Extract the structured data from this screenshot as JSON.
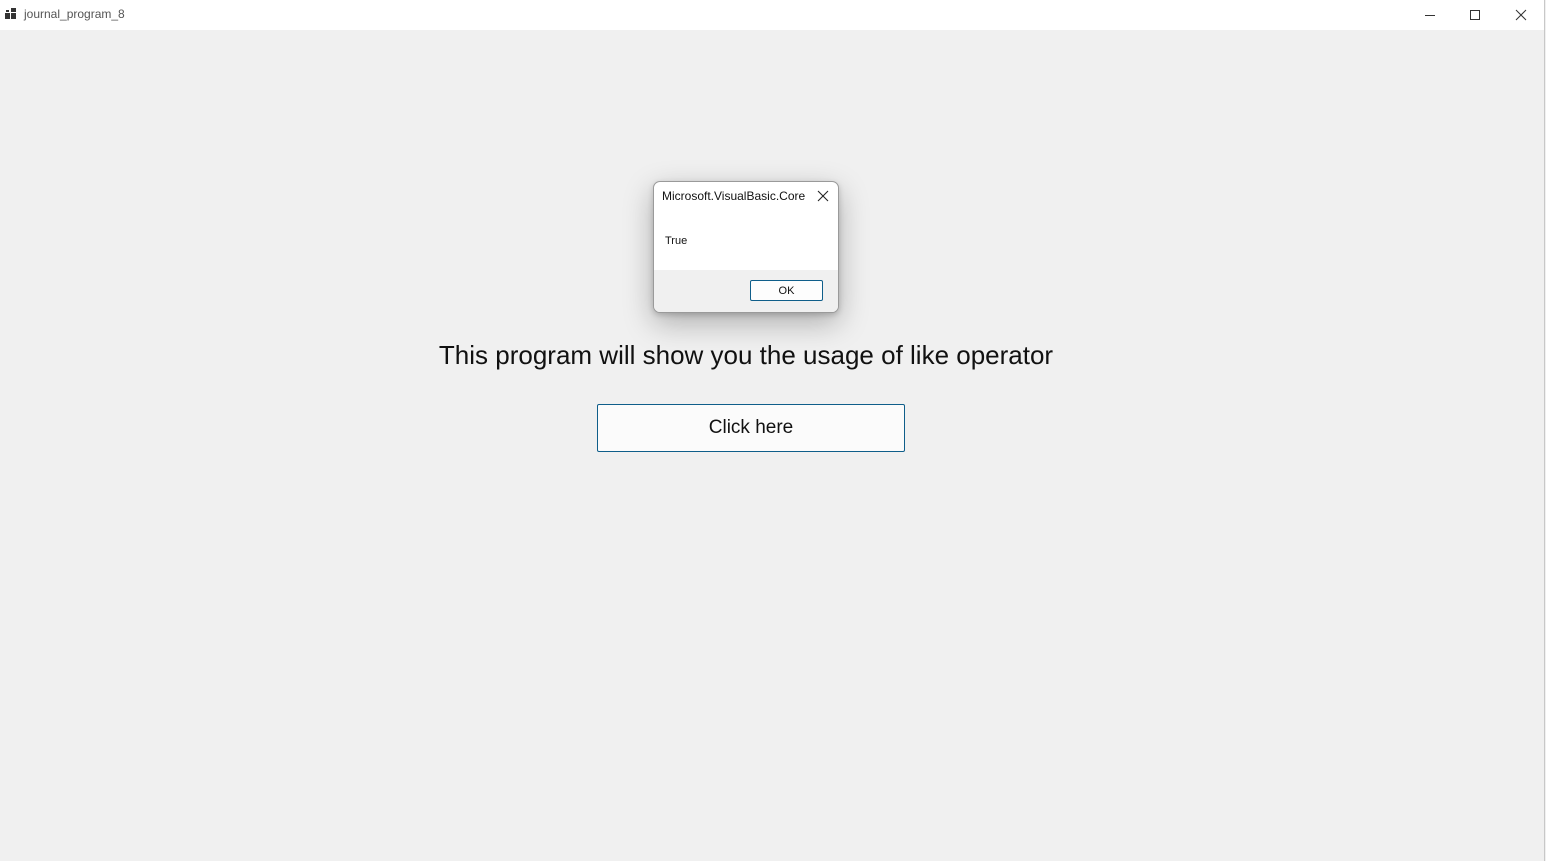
{
  "window": {
    "title": "journal_program_8",
    "icon": "app-icon",
    "controls": {
      "minimize_icon": "minimize-icon",
      "maximize_icon": "maximize-icon",
      "close_icon": "close-icon"
    }
  },
  "main": {
    "label": "This program will show you the usage of like operator",
    "button_label": "Click here"
  },
  "dialog": {
    "title": "Microsoft.VisualBasic.Core",
    "message": "True",
    "ok_label": "OK",
    "close_icon": "close-icon"
  },
  "colors": {
    "window_bg": "#f0f0f0",
    "titlebar_bg": "#ffffff",
    "button_border": "#0f5e8a"
  }
}
